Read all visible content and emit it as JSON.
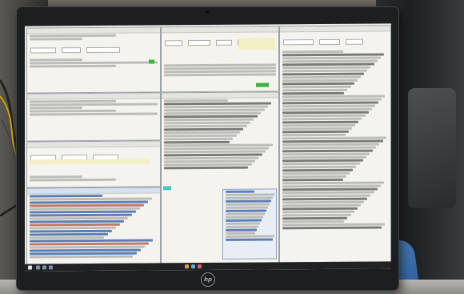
{
  "scene": {
    "monitor_brand": "hp"
  },
  "colors": {
    "screen_bg": "#ecebe4",
    "window_bg": "#f4f3ee",
    "accent_green": "#3bb43b",
    "accent_teal": "#49c7c4",
    "list_blue": "#5d7fb5",
    "taskbar": "#202225"
  }
}
